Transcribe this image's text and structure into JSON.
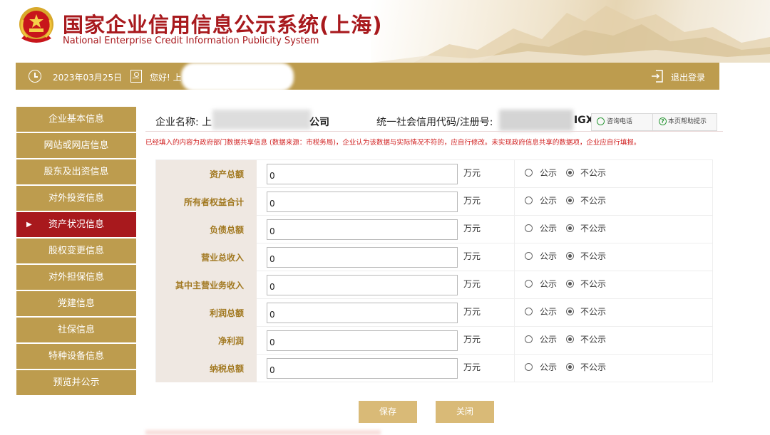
{
  "header": {
    "title_cn": "国家企业信用信息公示系统(上海)",
    "title_en": "National Enterprise Credit Information Publicity System"
  },
  "topbar": {
    "date": "2023年03月25日",
    "greeting": "您好! 上",
    "logout_label": "退出登录"
  },
  "sidebar": {
    "items": [
      {
        "label": "企业基本信息",
        "active": false
      },
      {
        "label": "网站或网店信息",
        "active": false
      },
      {
        "label": "股东及出资信息",
        "active": false
      },
      {
        "label": "对外投资信息",
        "active": false
      },
      {
        "label": "资产状况信息",
        "active": true
      },
      {
        "label": "股权变更信息",
        "active": false
      },
      {
        "label": "对外担保信息",
        "active": false
      },
      {
        "label": "党建信息",
        "active": false
      },
      {
        "label": "社保信息",
        "active": false
      },
      {
        "label": "特种设备信息",
        "active": false
      },
      {
        "label": "预览并公示",
        "active": false
      }
    ],
    "active_marker": "▶"
  },
  "company": {
    "name_label": "企业名称: 上",
    "name_suffix": "公司",
    "credit_label": "统一社会信用代码/注册号:",
    "credit_suffix": "IGX\\"
  },
  "help": {
    "phone_label": "咨询电话",
    "help_label": "本页帮助提示",
    "help_icon_glyph": "?"
  },
  "notice": "已经填入的内容为政府部门数据共享信息 (数据来源：市税务局)，企业认为该数据与实际情况不符的，应自行修改。未实现政府信息共享的数据项，企业应自行填报。",
  "form": {
    "unit": "万元",
    "public_label": "公示",
    "private_label": "不公示",
    "rows": [
      {
        "label": "资产总额",
        "value": "0",
        "public": false
      },
      {
        "label": "所有者权益合计",
        "value": "0",
        "public": false
      },
      {
        "label": "负债总额",
        "value": "0",
        "public": false
      },
      {
        "label": "营业总收入",
        "value": "0",
        "public": false
      },
      {
        "label": "其中主营业务收入",
        "value": "0",
        "public": false
      },
      {
        "label": "利润总额",
        "value": "0",
        "public": false
      },
      {
        "label": "净利润",
        "value": "0",
        "public": false
      },
      {
        "label": "纳税总额",
        "value": "0",
        "public": false
      }
    ]
  },
  "buttons": {
    "save_label": "保存",
    "close_label": "关闭"
  },
  "colors": {
    "brand_red": "#a8191d",
    "gold": "#bd9c4e",
    "button_gold": "#d9ba77",
    "label_bg": "#efe8e2",
    "label_text": "#a1781f",
    "notice_red": "#d01f1f"
  }
}
